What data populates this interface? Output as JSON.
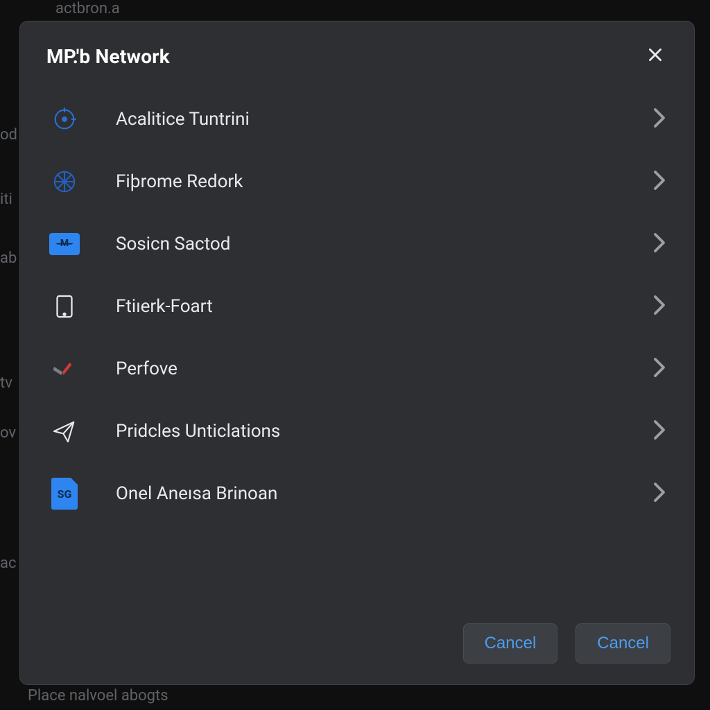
{
  "background": {
    "top_fragment": "actbron.a",
    "left_fragments": [
      "od",
      "iti",
      "ab",
      "tv",
      "ov",
      "ac"
    ],
    "bottom_text": "Place nalvoel abogts"
  },
  "modal": {
    "title": "MP.'b Network",
    "close_aria": "Close",
    "items": [
      {
        "icon": "target-icon",
        "label": "Acalitice Tuntrini"
      },
      {
        "icon": "compass-icon",
        "label": "Fiþrome Redork"
      },
      {
        "icon": "mail-icon",
        "label": "Sosicn Sactod"
      },
      {
        "icon": "tablet-icon",
        "label": "Ftiıerk-Foart"
      },
      {
        "icon": "check-icon",
        "label": "Perfove"
      },
      {
        "icon": "send-icon",
        "label": "Pridcles Unticlations"
      },
      {
        "icon": "file-sg-icon",
        "label": "Onel Aneısa Brinoan",
        "badge": "SG"
      }
    ],
    "footer": {
      "button_left": "Cancel",
      "button_right": "Cancel"
    }
  }
}
